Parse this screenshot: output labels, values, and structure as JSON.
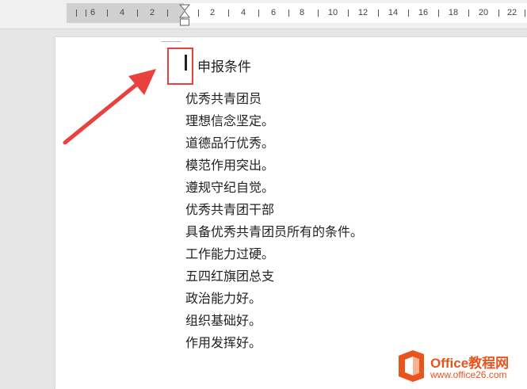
{
  "ruler": {
    "labels": [
      "6",
      "4",
      "2",
      "2",
      "4",
      "6",
      "8",
      "10",
      "12",
      "14",
      "16",
      "18",
      "20",
      "22"
    ]
  },
  "document": {
    "heading": "申报条件",
    "lines": [
      "优秀共青团员",
      "理想信念坚定。",
      "道德品行优秀。",
      "模范作用突出。",
      "遵规守纪自觉。",
      "优秀共青团干部",
      "具备优秀共青团员所有的条件。",
      "工作能力过硬。",
      "五四红旗团总支",
      "政治能力好。",
      "组织基础好。",
      "作用发挥好。"
    ]
  },
  "watermark": {
    "line1": "Office教程网",
    "line2": "www.office26.com"
  },
  "colors": {
    "highlight": "#e8413e",
    "logo": "#e8541d"
  }
}
